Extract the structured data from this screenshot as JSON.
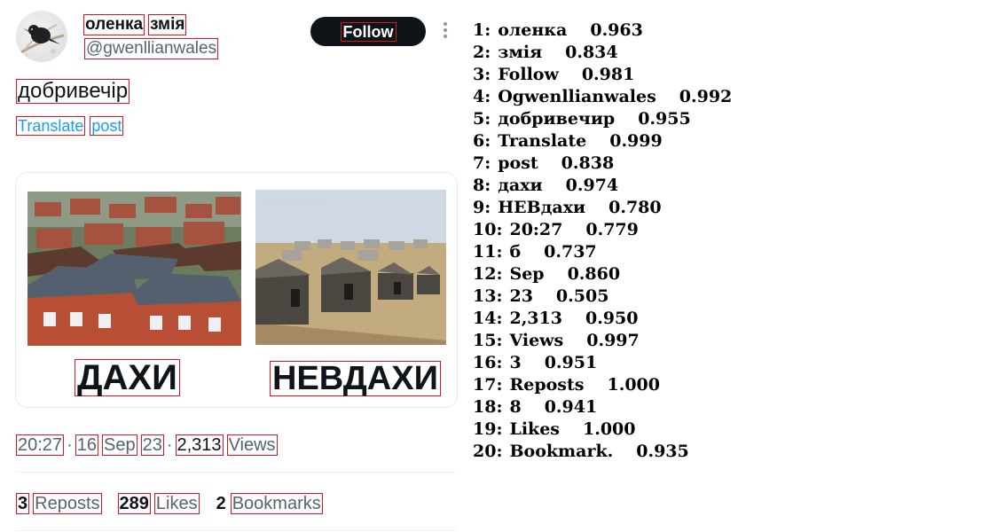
{
  "tweet": {
    "author_first": "оленка",
    "author_last": "змія",
    "handle": "@gwenllianwales",
    "follow_label": "Follow",
    "text": "добривечір",
    "translate_word1": "Translate",
    "translate_word2": "post",
    "image_watermark": "@gwenllianwales",
    "caption_left": "ДАХИ",
    "caption_right": "НЕВДАХИ",
    "time": "20:27",
    "day": "16",
    "month": "Sep",
    "year": "23",
    "views_count": "2,313",
    "views_label": "Views",
    "reposts_count": "3",
    "reposts_label": "Reposts",
    "likes_count": "289",
    "likes_label": "Likes",
    "bookmarks_count": "2",
    "bookmarks_label": "Bookmarks"
  },
  "ocr_results": [
    {
      "idx": "1:",
      "text": "оленка",
      "score": "0.963"
    },
    {
      "idx": "2:",
      "text": "змія",
      "score": "0.834"
    },
    {
      "idx": "3:",
      "text": "Follow",
      "score": "0.981"
    },
    {
      "idx": "4:",
      "text": "Ogwenllianwales",
      "score": "0.992"
    },
    {
      "idx": "5:",
      "text": "добривечир",
      "score": "0.955"
    },
    {
      "idx": "6:",
      "text": "Translate",
      "score": "0.999"
    },
    {
      "idx": "7:",
      "text": "post",
      "score": "0.838"
    },
    {
      "idx": "8:",
      "text": "дахи",
      "score": "0.974"
    },
    {
      "idx": "9:",
      "text": "НЕВдахи",
      "score": "0.780"
    },
    {
      "idx": "10:",
      "text": "20:27",
      "score": "0.779"
    },
    {
      "idx": "11:",
      "text": "б",
      "score": "0.737"
    },
    {
      "idx": "12:",
      "text": "Sep",
      "score": "0.860"
    },
    {
      "idx": "13:",
      "text": "23",
      "score": "0.505"
    },
    {
      "idx": "14:",
      "text": "2,313",
      "score": "0.950"
    },
    {
      "idx": "15:",
      "text": "Views",
      "score": "0.997"
    },
    {
      "idx": "16:",
      "text": "3",
      "score": "0.951"
    },
    {
      "idx": "17:",
      "text": "Reposts",
      "score": "1.000"
    },
    {
      "idx": "18:",
      "text": "8",
      "score": "0.941"
    },
    {
      "idx": "19:",
      "text": "Likes",
      "score": "1.000"
    },
    {
      "idx": "20:",
      "text": "Bookmark.",
      "score": "0.935"
    }
  ],
  "icons": {
    "more": "more-horizontal-icon"
  },
  "colors": {
    "box": "#e0141e",
    "link": "#1d9bf0",
    "muted": "#536471",
    "text": "#0f1419",
    "follow_bg": "#0f1419"
  }
}
